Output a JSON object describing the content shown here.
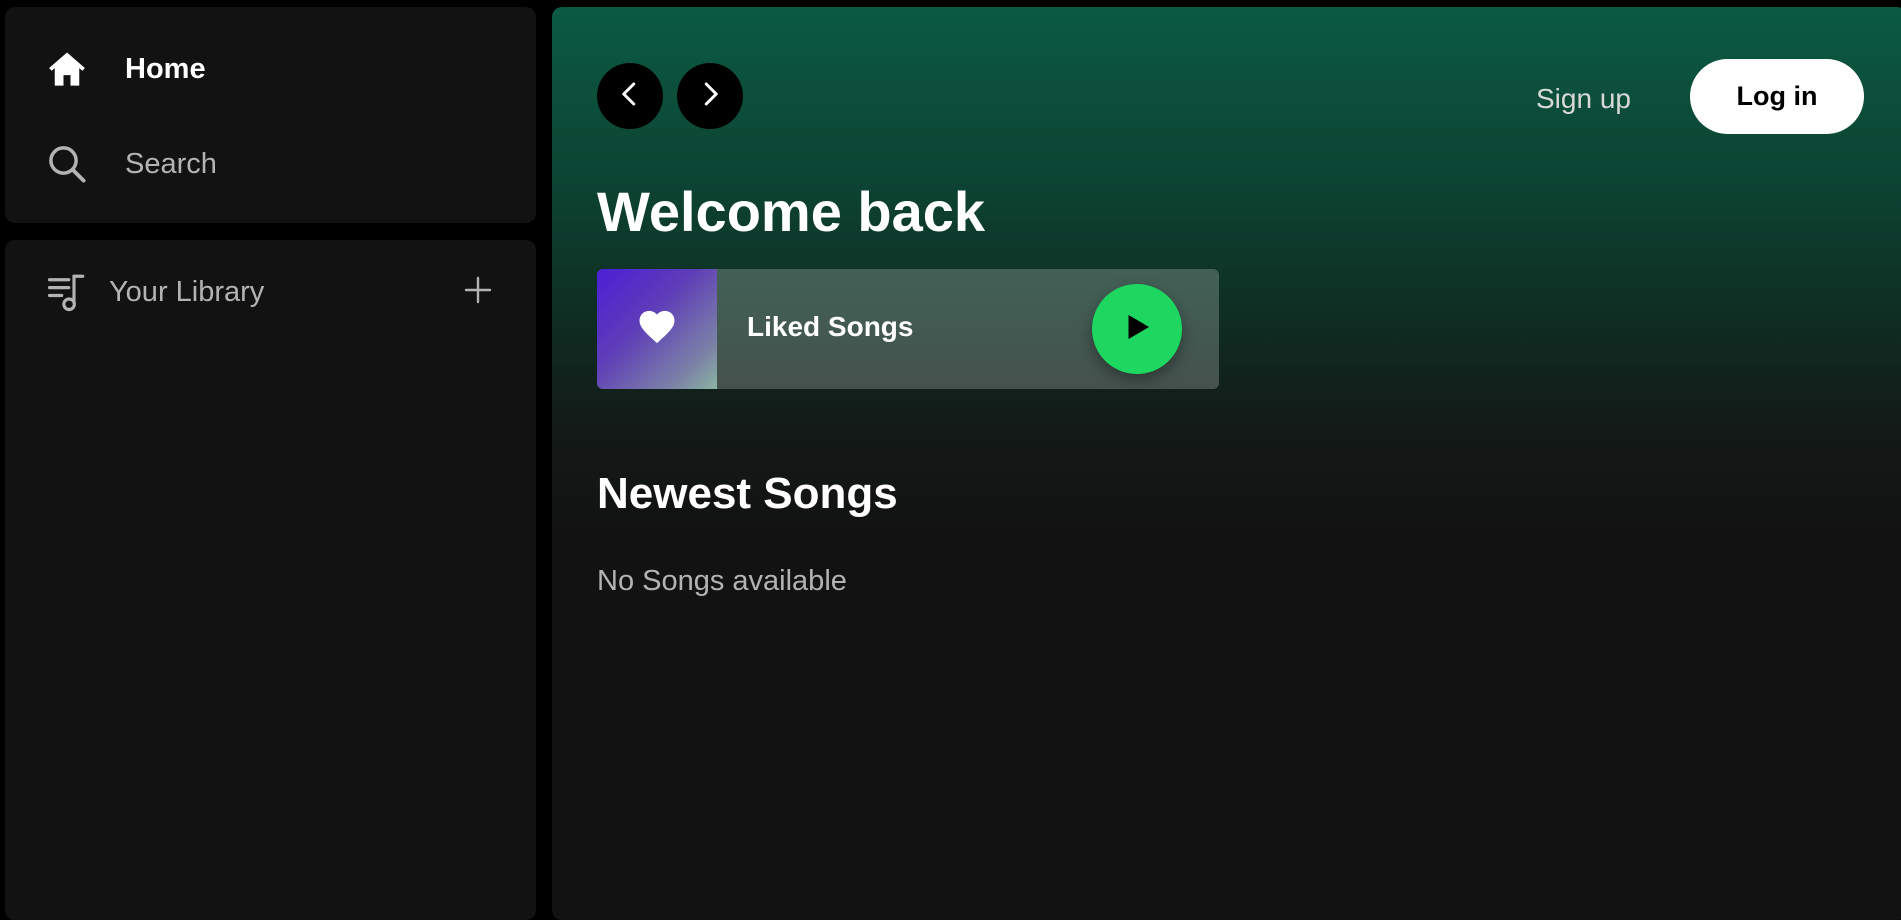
{
  "sidebar": {
    "nav": [
      {
        "label": "Home",
        "icon": "home-icon"
      },
      {
        "label": "Search",
        "icon": "search-icon"
      }
    ],
    "library": {
      "label": "Your Library",
      "icon": "library-icon",
      "add_icon": "plus-icon"
    }
  },
  "header": {
    "back_icon": "chevron-left-icon",
    "forward_icon": "chevron-right-icon",
    "signup_label": "Sign up",
    "login_label": "Log in"
  },
  "main": {
    "title": "Welcome back",
    "liked_card": {
      "label": "Liked Songs",
      "art_icon": "heart-icon",
      "play_icon": "play-icon"
    },
    "newest_section": {
      "title": "Newest Songs",
      "empty_message": "No Songs available"
    }
  },
  "colors": {
    "background": "#000000",
    "panel": "#121212",
    "accent_green": "#1ed760",
    "header_gradient_top": "#0b5a43"
  }
}
